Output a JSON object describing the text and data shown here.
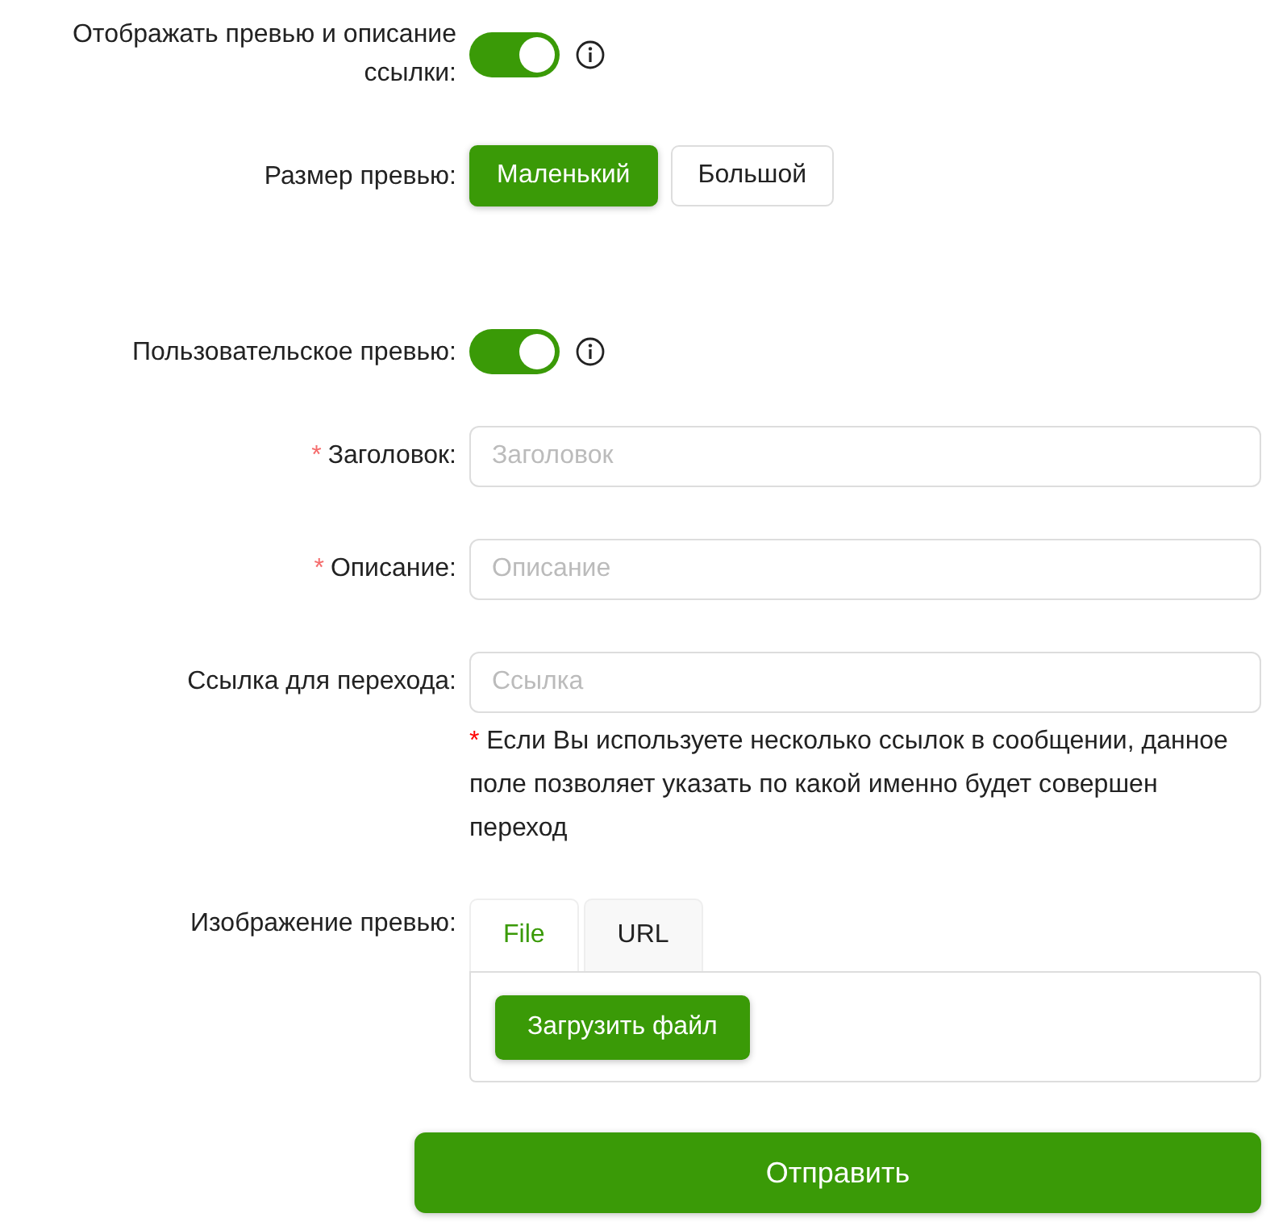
{
  "rows": [
    {
      "kind": "toggle",
      "label": "Отображать превью и описание ссылки:",
      "on": true,
      "info": true
    },
    {
      "kind": "choice",
      "label": "Размер превью:",
      "options": [
        {
          "label": "Маленький",
          "selected": true
        },
        {
          "label": "Большой",
          "selected": false
        }
      ]
    },
    {
      "kind": "toggle",
      "label": "Пользовательское превью:",
      "on": true,
      "info": true
    },
    {
      "kind": "field",
      "label": "Заголовок:",
      "required_mark": "*",
      "placeholder": "Заголовок"
    },
    {
      "kind": "field",
      "label": "Описание:",
      "required_mark": "*",
      "placeholder": "Описание"
    },
    {
      "kind": "field",
      "label": "Ссылка для перехода:",
      "placeholder": "Ссылка",
      "note": {
        "mark": "*",
        "text": "Если Вы используете несколько ссылок в сообщении, данное поле позволяет указать по какой именно будет совершен переход"
      }
    },
    {
      "kind": "tabs",
      "label": "Изображение превью:",
      "tabs": [
        {
          "label": "File",
          "selected": true
        },
        {
          "label": "URL",
          "selected": false
        }
      ],
      "button": "Загрузить файл"
    }
  ],
  "submit": "Отправить"
}
